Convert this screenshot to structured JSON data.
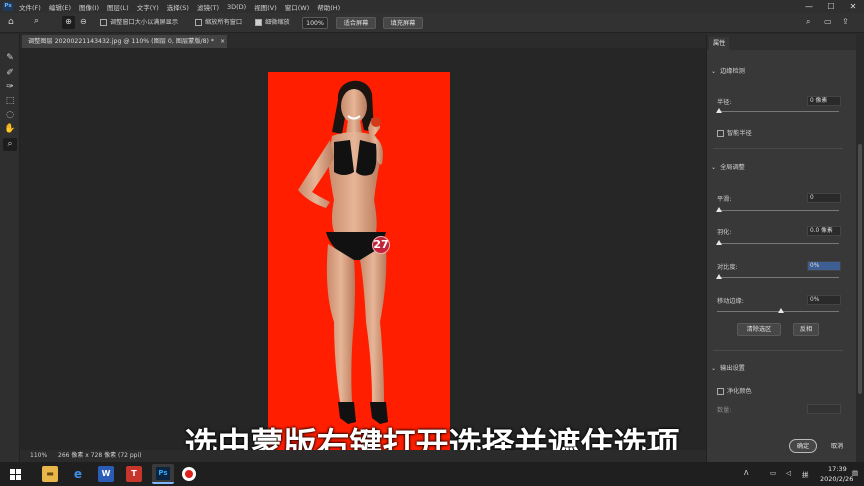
{
  "menubar": {
    "app_badge": "Ps",
    "items": [
      "文件(F)",
      "编辑(E)",
      "图像(I)",
      "图层(L)",
      "文字(Y)",
      "选择(S)",
      "滤镜(T)",
      "3D(D)",
      "视图(V)",
      "窗口(W)",
      "帮助(H)"
    ],
    "min": "—",
    "max": "☐",
    "close": "✕"
  },
  "options": {
    "resize_windows": "调整窗口大小以满屏显示",
    "zoom_all": "缩放所有窗口",
    "scrubby_zoom": "细微缩放",
    "zoom_value": "100%",
    "fit_screen": "适合屏幕",
    "fill_screen": "填充屏幕"
  },
  "document": {
    "tab_title": "调整图层 20200221143432.jpg @ 110% (图层 0, 图层蒙版/8) *",
    "tab_close": "×"
  },
  "photo": {
    "bib_number": "27"
  },
  "subtitle": "选中蒙版右键打开选择并遮住选项",
  "status": {
    "zoom": "110%",
    "dimensions": "266 像素 x 728 像素 (72 ppi)"
  },
  "panel": {
    "tab": "属性",
    "edge_detection": "边缘检测",
    "radius_label": "半径:",
    "radius_value": "0 像素",
    "smart_radius": "智能半径",
    "global_refinement": "全局调整",
    "smooth_label": "平滑:",
    "smooth_value": "0",
    "feather_label": "羽化:",
    "feather_value": "0.0 像素",
    "contrast_label": "对比度:",
    "contrast_value": "0%",
    "shift_edge_label": "移动边缘:",
    "shift_edge_value": "0%",
    "clear_selection": "清除选区",
    "invert": "反相",
    "output_settings": "输出设置",
    "decontaminate": "净化颜色",
    "amount_label": "数量:",
    "ok": "确定",
    "cancel": "取消"
  },
  "taskbar": {
    "start_icon": "windows-start-icon",
    "ime": "拼",
    "time": "17:39",
    "date": "2020/2/26"
  },
  "colors": {
    "canvas_bg": "#ff1e00",
    "accent_highlight": "#3d5f93"
  }
}
